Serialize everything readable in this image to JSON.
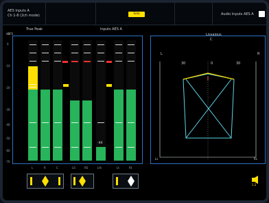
{
  "header": {
    "top_left_line1": "AES Inputs A",
    "top_left_line2": "Ch 1-8 (2ch mode)",
    "top_mid_label": "",
    "center_button": "Solo Phase",
    "top_right_label": "Audio Inputs AES A"
  },
  "left": {
    "label_true_peak": "True Peak",
    "label_inputs": "Inputs AES A",
    "scale_label": "dBFS",
    "scale": [
      "0",
      "-10",
      "-20",
      "-30",
      "-40",
      "-50",
      "-60",
      "-70"
    ],
    "channel_labels": [
      "L",
      "R",
      "C",
      "LS",
      "RS",
      "Lfe",
      "Lt",
      "Rt"
    ],
    "meters": [
      {
        "name": "L",
        "level": 0.78,
        "peak_yellow": [
          0.52,
          0.74
        ]
      },
      {
        "name": "R",
        "level": 0.78
      },
      {
        "name": "C",
        "level": 0.78
      },
      {
        "name": "LS",
        "level": 0.66
      },
      {
        "name": "RS",
        "level": 0.66
      },
      {
        "name": "Lfe",
        "level": 0.2
      },
      {
        "name": "Lt",
        "level": 0.78
      },
      {
        "name": "Rt",
        "level": 0.78
      }
    ],
    "lfe_readout": "-44"
  },
  "right": {
    "title": "Lissajous",
    "sub": "C",
    "label_l": "L",
    "label_r": "R",
    "label_30": "30",
    "label_0": "0",
    "label_30b": "30",
    "label_ls": "Ls",
    "label_rs": "Rs",
    "bottom_readout": "1.2"
  }
}
